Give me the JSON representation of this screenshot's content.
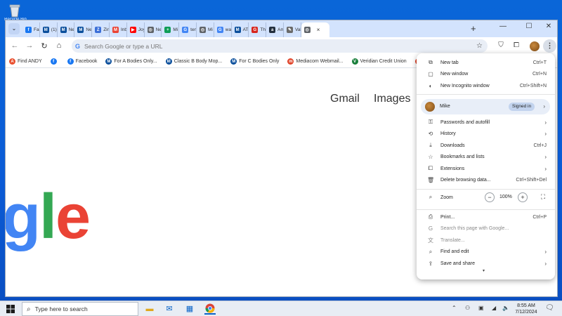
{
  "desktop": {
    "recycle_bin_label": "Recycle Bin"
  },
  "tabs": {
    "list": [
      {
        "icon": "facebook-icon",
        "label": "Fac",
        "color": "#1877f2",
        "glyph": "f"
      },
      {
        "icon": "mopar-icon",
        "label": "(1)",
        "color": "#0b4f9c",
        "glyph": "M"
      },
      {
        "icon": "mopar-icon",
        "label": "Ne",
        "color": "#0b4f9c",
        "glyph": "M"
      },
      {
        "icon": "mopar-icon",
        "label": "Ne",
        "color": "#0b4f9c",
        "glyph": "M"
      },
      {
        "icon": "zin-icon",
        "label": "Zin",
        "color": "#3b6fd8",
        "glyph": "Z"
      },
      {
        "icon": "gmail-icon",
        "label": "Inb",
        "color": "#ea4335",
        "glyph": "M"
      },
      {
        "icon": "youtube-icon",
        "label": "Joy",
        "color": "#ff0000",
        "glyph": "▶"
      },
      {
        "icon": "chrome-icon",
        "label": "Ne",
        "color": "#5f6368",
        "glyph": "◎"
      },
      {
        "icon": "sheets-icon",
        "label": "Mi",
        "color": "#0f9d58",
        "glyph": "+"
      },
      {
        "icon": "google-icon",
        "label": "ten",
        "color": "#4285f4",
        "glyph": "G"
      },
      {
        "icon": "globe-icon",
        "label": "Mi",
        "color": "#5f6368",
        "glyph": "◎"
      },
      {
        "icon": "google-icon",
        "label": "wa",
        "color": "#4285f4",
        "glyph": "G"
      },
      {
        "icon": "mopar-icon",
        "label": "AT",
        "color": "#0b4f9c",
        "glyph": "M"
      },
      {
        "icon": "store-icon",
        "label": "Thi",
        "color": "#d7261e",
        "glyph": "G"
      },
      {
        "icon": "amazon-icon",
        "label": "Am",
        "color": "#232f3e",
        "glyph": "a"
      },
      {
        "icon": "pen-icon",
        "label": "Val",
        "color": "#6a6a6a",
        "glyph": "✎"
      }
    ],
    "active": {
      "icon": "chrome-icon",
      "label": "",
      "close": "×"
    },
    "new_tab": "+"
  },
  "window_controls": {
    "minimize": "—",
    "maximize": "☐",
    "close": "✕"
  },
  "toolbar": {
    "back": "←",
    "forward": "→",
    "reload": "↻",
    "home": "⌂",
    "omnibox_placeholder": "Search Google or type a URL",
    "star": "☆"
  },
  "bookmarks": [
    {
      "icon": "andy-icon",
      "label": "Find ANDY",
      "color": "#e94f2e",
      "glyph": "A"
    },
    {
      "icon": "facebook-icon",
      "label": "",
      "color": "#1877f2",
      "glyph": "f"
    },
    {
      "icon": "facebook-icon",
      "label": "Facebook",
      "color": "#1877f2",
      "glyph": "f"
    },
    {
      "icon": "mopar-icon",
      "label": "For A Bodies Only...",
      "color": "#0b4f9c",
      "glyph": "M"
    },
    {
      "icon": "mopar-icon",
      "label": "Classic B Body Mop...",
      "color": "#0b4f9c",
      "glyph": "M"
    },
    {
      "icon": "mopar-icon",
      "label": "For C Bodies Only",
      "color": "#0b4f9c",
      "glyph": "M"
    },
    {
      "icon": "mediacom-icon",
      "label": "Mediacom Webmail...",
      "color": "#e0452b",
      "glyph": "m"
    },
    {
      "icon": "veridian-icon",
      "label": "Veridian Credit Union",
      "color": "#1a7f3c",
      "glyph": "V"
    },
    {
      "icon": "more-bookmark-icon",
      "label": "",
      "color": "#e0452b",
      "glyph": "»"
    }
  ],
  "page": {
    "gmail": "Gmail",
    "images": "Images",
    "logo_letters": [
      {
        "ch": "g",
        "color": "#4285f4"
      },
      {
        "ch": "l",
        "color": "#34a853"
      },
      {
        "ch": "e",
        "color": "#ea4335"
      }
    ]
  },
  "menu": {
    "items_top": [
      {
        "icon": "new-tab-icon",
        "glyph": "⧉",
        "label": "New tab",
        "shortcut": "Ctrl+T"
      },
      {
        "icon": "new-window-icon",
        "glyph": "▢",
        "label": "New window",
        "shortcut": "Ctrl+N"
      },
      {
        "icon": "incognito-icon",
        "glyph": "◐",
        "label": "New Incognito window",
        "shortcut": "Ctrl+Shift+N"
      }
    ],
    "profile": {
      "name": "Mike",
      "status": "Signed in"
    },
    "items_mid": [
      {
        "icon": "key-icon",
        "glyph": "⚿",
        "label": "Passwords and autofill",
        "chevron": true
      },
      {
        "icon": "history-icon",
        "glyph": "⟲",
        "label": "History",
        "chevron": true
      },
      {
        "icon": "download-icon",
        "glyph": "⤓",
        "label": "Downloads",
        "shortcut": "Ctrl+J"
      },
      {
        "icon": "bookmark-star-icon",
        "glyph": "☆",
        "label": "Bookmarks and lists",
        "chevron": true
      },
      {
        "icon": "extensions-icon",
        "glyph": "⧠",
        "label": "Extensions",
        "chevron": true
      },
      {
        "icon": "trash-icon",
        "glyph": "🗑",
        "label": "Delete browsing data...",
        "shortcut": "Ctrl+Shift+Del"
      }
    ],
    "zoom": {
      "label": "Zoom",
      "value": "100%",
      "minus": "−",
      "plus": "+",
      "fullscreen": "⛶"
    },
    "items_bottom": [
      {
        "icon": "print-icon",
        "glyph": "⎙",
        "label": "Print...",
        "shortcut": "Ctrl+P"
      },
      {
        "icon": "google-search-icon",
        "glyph": "G",
        "label": "Search this page with Google...",
        "disabled": true
      },
      {
        "icon": "translate-icon",
        "glyph": "文",
        "label": "Translate...",
        "disabled": true
      },
      {
        "icon": "find-edit-icon",
        "glyph": "⌕",
        "label": "Find and edit",
        "chevron": true
      },
      {
        "icon": "share-icon",
        "glyph": "⇪",
        "label": "Save and share",
        "chevron": true
      }
    ],
    "scroll_more": "▾"
  },
  "taskbar": {
    "search_placeholder": "Type here to search",
    "time": "8:55 AM",
    "date": "7/12/2024"
  }
}
